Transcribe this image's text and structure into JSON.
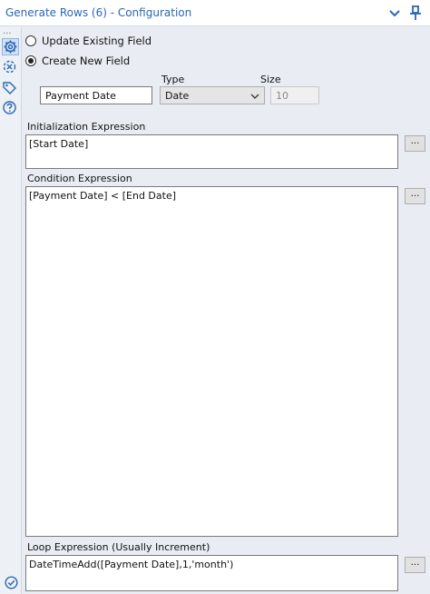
{
  "header": {
    "title": "Generate Rows (6) - Configuration",
    "collapse_icon": "chevron-down-icon",
    "pin_icon": "pin-icon"
  },
  "sidebar": {
    "overflow": "...",
    "icons": [
      "gear-icon",
      "connection-icon",
      "tag-icon",
      "help-icon"
    ],
    "bottom_icon": "check-circle-icon"
  },
  "mode": {
    "options": [
      {
        "label": "Update Existing Field",
        "selected": false
      },
      {
        "label": "Create New  Field",
        "selected": true
      }
    ]
  },
  "new_field": {
    "name_value": "Payment Date",
    "type_label": "Type",
    "type_value": "Date",
    "size_label": "Size",
    "size_value": "10"
  },
  "initialization": {
    "label": "Initialization Expression",
    "value": "[Start Date]",
    "button": "..."
  },
  "condition": {
    "label": "Condition Expression",
    "value": "[Payment Date] < [End Date]",
    "button": "..."
  },
  "loop": {
    "label": "Loop Expression (Usually Increment)",
    "value": "DateTimeAdd([Payment Date],1,'month')",
    "button": "..."
  },
  "colors": {
    "title": "#2a66b6",
    "panel_bg": "#e9edf3",
    "active_icon_bg": "#cfe0f5"
  }
}
